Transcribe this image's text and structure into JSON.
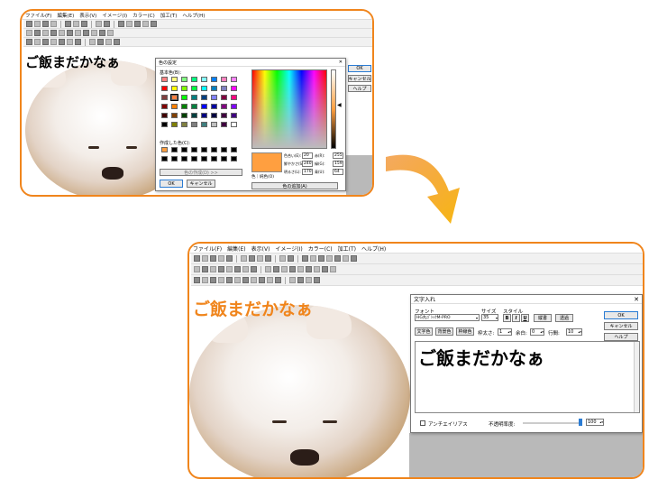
{
  "top": {
    "menu": [
      "ファイル(F)",
      "編集(E)",
      "表示(V)",
      "イメージ(I)",
      "カラー(C)",
      "加工(T)",
      "ヘルプ(H)"
    ],
    "caption": "ご飯まだかなぁ",
    "color_dialog": {
      "title": "色の設定",
      "basic_colors_label": "基本色(B):",
      "custom_colors_label": "作成した色(C):",
      "define_custom_button": "色の作成(D) >>",
      "ok_button": "OK",
      "cancel_button": "キャンセル",
      "solid_label": "色｜純色(O)",
      "add_custom_button": "色の追加(A)",
      "fields": [
        {
          "label": "色合い(E):",
          "value": "20"
        },
        {
          "label": "鮮やかさ(S):",
          "value": "240"
        },
        {
          "label": "明るさ(L):",
          "value": "170"
        },
        {
          "label": "赤(R):",
          "value": "255"
        },
        {
          "label": "緑(G):",
          "value": "159"
        },
        {
          "label": "青(U):",
          "value": "64"
        }
      ],
      "selected_color": "#ff9f40"
    },
    "side_buttons": [
      "OK",
      "キャンセル",
      "ヘルプ"
    ]
  },
  "bottom": {
    "menu": [
      "ファイル(F)",
      "編集(E)",
      "表示(V)",
      "イメージ(I)",
      "カラー(C)",
      "加工(T)",
      "ヘルプ(H)"
    ],
    "caption": "ご飯まだかなぁ",
    "caption_color": "#f0851c",
    "text_dialog": {
      "title": "文字入れ",
      "font_label": "フォント",
      "font_value": "HG丸ｺﾞｼｯｸM-PRO",
      "size_label": "サイズ",
      "size_value": "35",
      "style_label": "スタイル",
      "bold": "B",
      "italic": "I",
      "underline": "U",
      "vertical_button": "縦書",
      "transparent_button": "透過",
      "text_color_button": "文字色",
      "bg_color_button": "背景色",
      "border_color_button": "枠線色",
      "border_width_label": "枠太さ:",
      "border_width_value": "1",
      "margin_label": "余白:",
      "margin_value": "0",
      "line_spacing_label": "行間:",
      "line_spacing_value": "10",
      "ok_button": "OK",
      "cancel_button": "キャンセル",
      "help_button": "ヘルプ",
      "preview_text": "ご飯まだかなぁ",
      "antialias_label": "アンチエイリアス",
      "opacity_label": "不透明率度:",
      "opacity_value": "100"
    }
  },
  "colors": {
    "accent": "#f0851c"
  }
}
